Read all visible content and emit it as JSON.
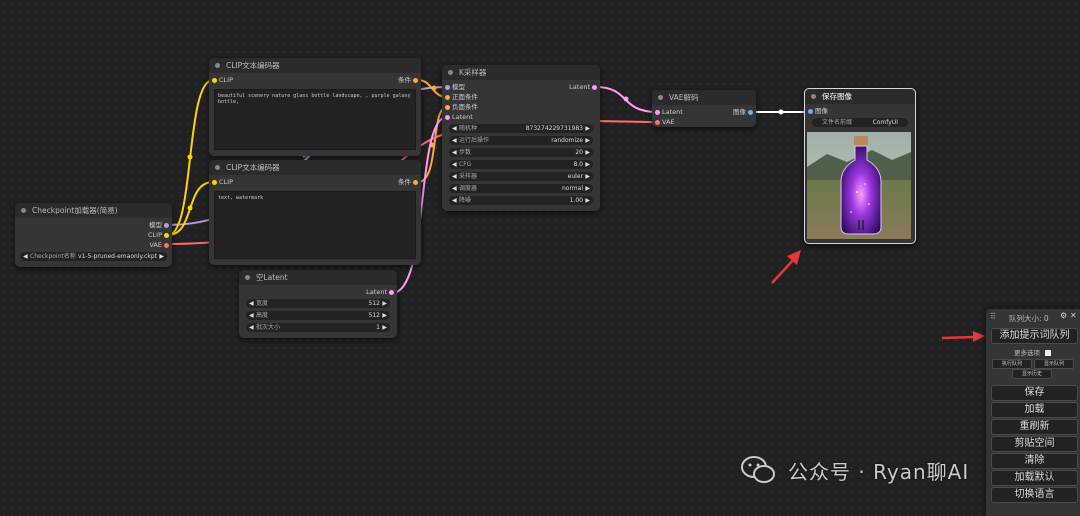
{
  "nodes": {
    "checkpoint": {
      "title": "Checkpoint加载器(简易)",
      "outputs": [
        "模型",
        "CLIP",
        "VAE"
      ],
      "widget_label": "Checkpoint名称",
      "widget_value": "v1-5-pruned-emaonly.ckpt"
    },
    "clip1": {
      "title": "CLIP文本编码器",
      "input": "CLIP",
      "output": "条件",
      "text": "beautiful scenery nature glass bottle landscape, , purple galaxy bottle,"
    },
    "clip2": {
      "title": "CLIP文本编码器",
      "input": "CLIP",
      "output": "条件",
      "text": "text, watermark"
    },
    "ksampler": {
      "title": "K采样器",
      "inputs": [
        "模型",
        "正面条件",
        "负面条件",
        "Latent"
      ],
      "output": "Latent",
      "widgets": [
        {
          "label": "随机种",
          "value": "873274229731983"
        },
        {
          "label": "运行后操作",
          "value": "randomize"
        },
        {
          "label": "步数",
          "value": "20"
        },
        {
          "label": "CFG",
          "value": "8.0"
        },
        {
          "label": "采样器",
          "value": "euler"
        },
        {
          "label": "调度器",
          "value": "normal"
        },
        {
          "label": "降噪",
          "value": "1.00"
        }
      ]
    },
    "latent": {
      "title": "空Latent",
      "output": "Latent",
      "widgets": [
        {
          "label": "宽度",
          "value": "512"
        },
        {
          "label": "高度",
          "value": "512"
        },
        {
          "label": "批次大小",
          "value": "1"
        }
      ]
    },
    "vae": {
      "title": "VAE解码",
      "inputs": [
        "Latent",
        "VAE"
      ],
      "output": "图像"
    },
    "save": {
      "title": "保存图像",
      "input": "图像",
      "widget_label": "文件名前缀",
      "widget_value": "ComfyUI"
    }
  },
  "menu": {
    "queue_size": "队列大小: 0",
    "queue_button": "添加提示词队列",
    "extra_options": "更多选项",
    "small_buttons": [
      "执行队列",
      "显示队列",
      "显示历史"
    ],
    "buttons": [
      "保存",
      "加载",
      "重刷新",
      "剪贴空间",
      "清除",
      "加载默认",
      "切换语言"
    ]
  },
  "watermark": "公众号 · Ryan聊AI",
  "colors": {
    "clip": "#ffd500",
    "conditioning": "#ffa931",
    "latent": "#ff9cf9",
    "vae": "#ff6e6e",
    "image": "#64b5f6",
    "model": "#b39ddb",
    "arrow": "#e53935"
  }
}
